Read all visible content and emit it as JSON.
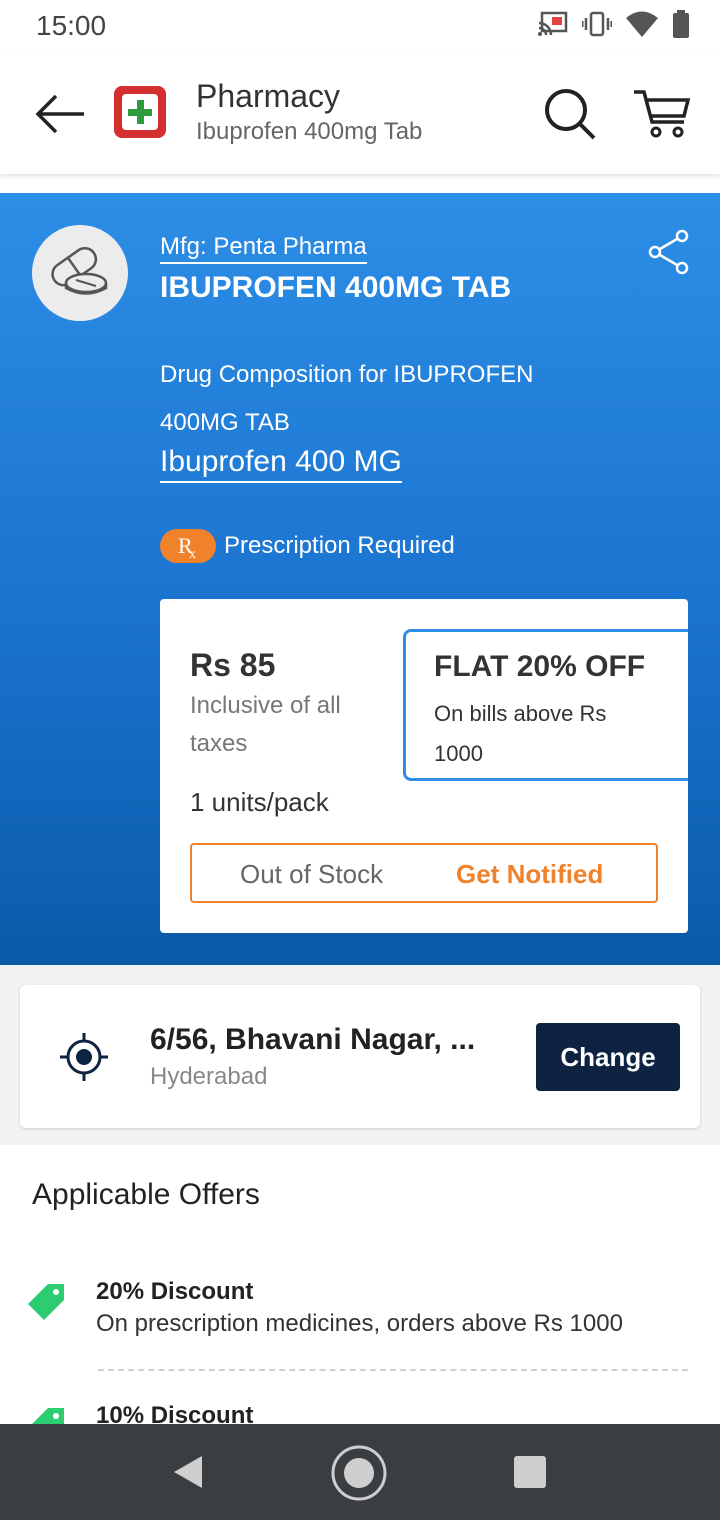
{
  "status_bar": {
    "time": "15:00"
  },
  "app_bar": {
    "title": "Pharmacy",
    "subtitle": "Ibuprofen 400mg Tab"
  },
  "product": {
    "manufacturer": "Mfg: Penta Pharma",
    "name": "IBUPROFEN 400MG TAB",
    "composition_label": "Drug Composition for IBUPROFEN 400MG TAB",
    "salt": "Ibuprofen 400 MG",
    "rx_badge": "Rx",
    "prescription_note": "Prescription Required"
  },
  "price_card": {
    "price": "Rs 85",
    "tax_note": "Inclusive of all taxes",
    "units": "1 units/pack",
    "offer_title": "FLAT 20% OFF",
    "offer_desc": "On bills above Rs 1000",
    "stock_status": "Out of Stock",
    "notify_label": "Get Notified"
  },
  "location": {
    "address": "6/56, Bhavani Nagar, ...",
    "city": "Hyderabad",
    "change_label": "Change"
  },
  "offers": {
    "title": "Applicable Offers",
    "items": [
      {
        "name": "20% Discount",
        "description": "On prescription medicines, orders above Rs 1000"
      },
      {
        "name": "10% Discount"
      }
    ]
  },
  "colors": {
    "primary_blue": "#1a73cf",
    "accent_orange": "#f0822b",
    "tag_green": "#2ecc71",
    "change_button": "#0d2341"
  }
}
